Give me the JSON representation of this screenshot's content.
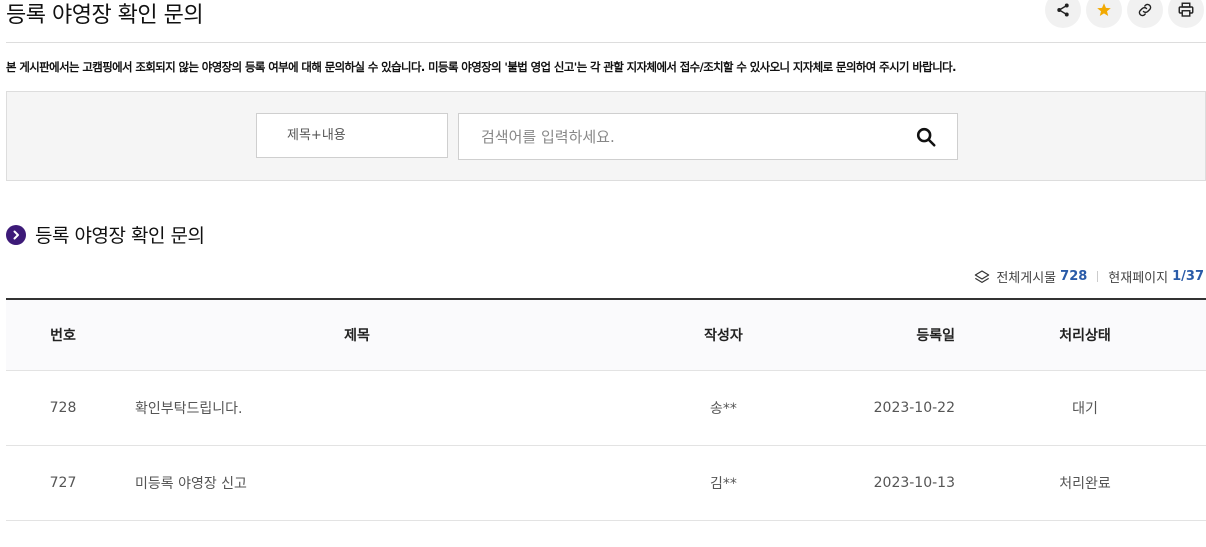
{
  "page": {
    "title": "등록 야영장 확인 문의"
  },
  "toolbar": {
    "icons": [
      "share-icon",
      "star-icon",
      "link-icon",
      "print-icon"
    ],
    "accent_star": "#f2a900"
  },
  "notice": "본 게시판에서는 고캠핑에서 조회되지 않는 야영장의 등록 여부에 대해 문의하실 수 있습니다. 미등록 야영장의 '불법 영업 신고'는 각 관할 지자체에서 접수/조치할 수 있사오니 지자체로 문의하여 주시기 바랍니다.",
  "search": {
    "scope_value": "제목+내용",
    "placeholder": "검색어를 입력하세요.",
    "icon": "search-icon"
  },
  "section": {
    "title": "등록 야영장 확인 문의",
    "bullet_color": "#3d1a78"
  },
  "counts": {
    "total_label": "전체게시물",
    "total_value": "728",
    "page_label": "현재페이지",
    "page_value": "1/37",
    "accent": "#2a5ba8"
  },
  "table": {
    "headers": {
      "num": "번호",
      "title": "제목",
      "author": "작성자",
      "date": "등록일",
      "status": "처리상태"
    },
    "rows": [
      {
        "num": "728",
        "title": "확인부탁드립니다.",
        "author": "송**",
        "date": "2023-10-22",
        "status": "대기"
      },
      {
        "num": "727",
        "title": "미등록 야영장 신고",
        "author": "김**",
        "date": "2023-10-13",
        "status": "처리완료"
      }
    ]
  }
}
